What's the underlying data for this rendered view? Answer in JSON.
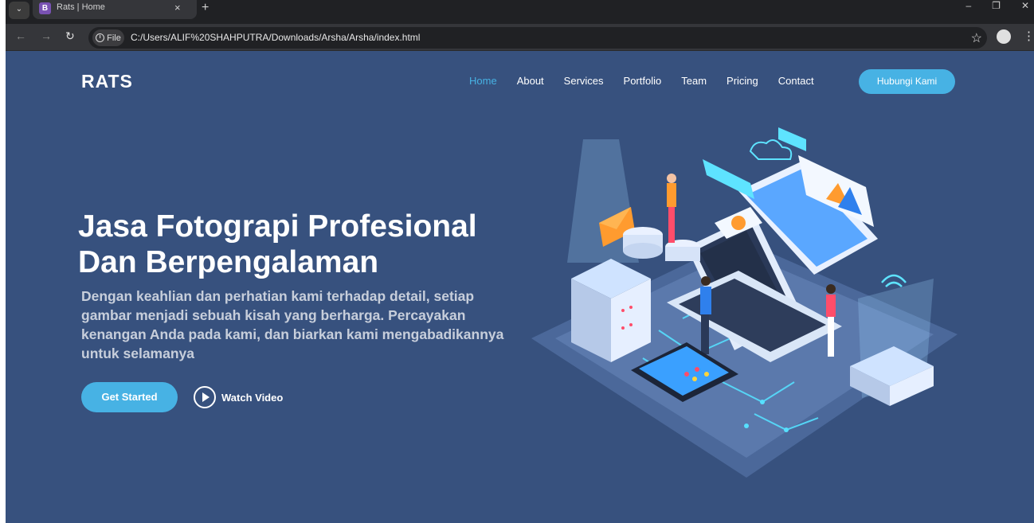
{
  "browser": {
    "tab_title": "Rats | Home",
    "tab_favicon": "B",
    "new_tab_label": "+",
    "info_label": "File",
    "url": "C:/Users/ALIF%20SHAHPUTRA/Downloads/Arsha/Arsha/index.html"
  },
  "site": {
    "logo": "RATS",
    "nav": [
      "Home",
      "About",
      "Services",
      "Portfolio",
      "Team",
      "Pricing",
      "Contact"
    ],
    "active_nav": "Home",
    "cta_label": "Hubungi Kami"
  },
  "hero": {
    "title": "Jasa Fotograpi Profesional Dan Berpengalaman",
    "description": "Dengan keahlian dan perhatian kami terhadap detail, setiap gambar menjadi sebuah kisah yang berharga. Percayakan kenangan Anda pada kami, dan biarkan kami mengabadikannya untuk selamanya",
    "get_started_label": "Get Started",
    "watch_video_label": "Watch Video"
  },
  "colors": {
    "background": "#37517e",
    "accent": "#47b2e4"
  },
  "icons": [
    "chevron-down-icon",
    "close-icon",
    "back-arrow-icon",
    "forward-arrow-icon",
    "reload-icon",
    "info-icon",
    "star-icon",
    "profile-icon",
    "menu-icon",
    "play-icon",
    "minimize-icon",
    "maximize-icon",
    "window-close-icon"
  ]
}
